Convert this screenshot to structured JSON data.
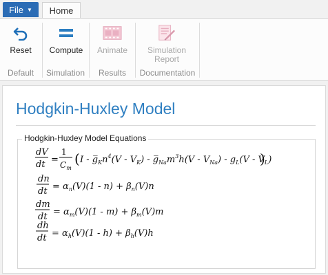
{
  "tabs": {
    "file": "File",
    "home": "Home"
  },
  "ribbon": {
    "groups": [
      {
        "label": "Default",
        "buttons": [
          {
            "label": "Reset",
            "icon": "undo-arrow-icon",
            "enabled": true
          }
        ]
      },
      {
        "label": "Simulation",
        "buttons": [
          {
            "label": "Compute",
            "icon": "equals-icon",
            "enabled": true
          }
        ]
      },
      {
        "label": "Results",
        "buttons": [
          {
            "label": "Animate",
            "icon": "film-strip-icon",
            "enabled": false
          }
        ]
      },
      {
        "label": "Documentation",
        "buttons": [
          {
            "label": "Simulation\nReport",
            "label_line1": "Simulation",
            "label_line2": "Report",
            "icon": "report-document-icon",
            "enabled": false
          }
        ]
      }
    ]
  },
  "main": {
    "title": "Hodgkin-Huxley Model",
    "equations_section": {
      "legend": "Hodgkin-Huxley Model Equations",
      "equations": [
        "dV/dt = 1/C_m ( I - ḡ_K n^4 (V - V_K) - ḡ_Na m^3 h (V - V_Na) - g_L (V - V_L) )",
        "dn/dt = α_n(V)(1 - n) + β_n(V)n",
        "dm/dt = α_m(V)(1 - m) + β_m(V)m",
        "dh/dt = α_h(V)(1 - h) + β_h(V)h"
      ]
    }
  },
  "colors": {
    "file_tab": "#2b6cb5",
    "title": "#2f7fc1",
    "compute_icon": "#2a7dc1",
    "reset_icon": "#1e6fb8"
  }
}
